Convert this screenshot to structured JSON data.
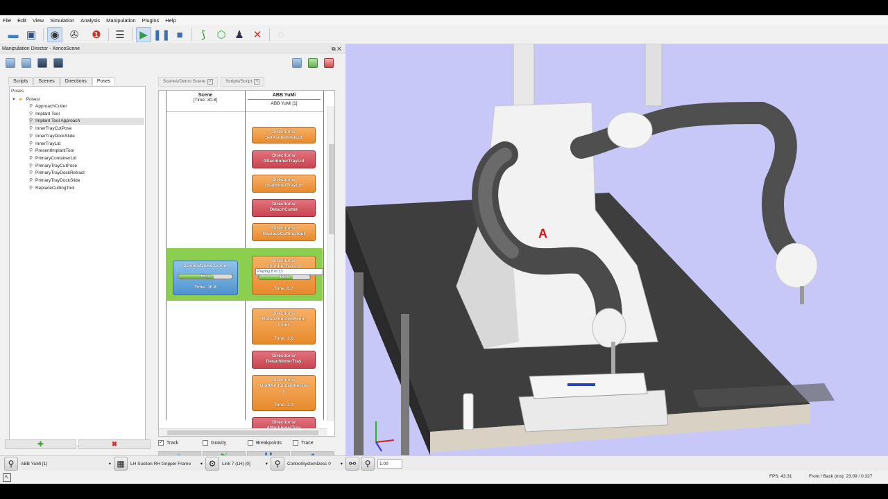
{
  "menu": [
    "File",
    "Edit",
    "View",
    "Simulation",
    "Analysis",
    "Manipulation",
    "Plugins",
    "Help"
  ],
  "panel": {
    "title": "Manipulation Director - XencoScene",
    "title_buttons": "⧉ ✕"
  },
  "left_tabs": [
    "Scripts",
    "Scenes",
    "Directions",
    "Poses"
  ],
  "active_left_tab": "Poses",
  "tree": {
    "header": "Poses",
    "folder": "Poses/",
    "items": [
      "ApproachCutter",
      "Implant Tool",
      "Implant Tool Approach",
      "InnerTrayCutPose",
      "InnerTrayDockSlide",
      "InnerTrayLid",
      "PresentImplantTool",
      "PrimaryContainerLid",
      "PrimaryTrayCutPose",
      "PrimaryTrayDockRetract",
      "PrimaryTrayDockSlide",
      "ReplaceCuttingTool"
    ],
    "selected_index": 2
  },
  "left_buttons": {
    "add": "✚",
    "remove": "✖"
  },
  "doc_tabs": [
    "Scenes/Demo Scene",
    "Scripts/Script"
  ],
  "columns": {
    "scene_title": "Scene",
    "scene_time": "[Time: 30.8]",
    "robot_title": "ABB YuMi",
    "robot_sub": "ABB YuMi [1]"
  },
  "scene_block": {
    "title": "Scenes/Demo Scene",
    "progress_label": "66%",
    "progress": 0.66,
    "time": "Time: 30.8"
  },
  "blocks": [
    {
      "color": "orange",
      "line1": "Directions/",
      "line2": "SetAsideInnerLid",
      "time": ""
    },
    {
      "color": "red",
      "line1": "Directions/",
      "line2": "AttachInnerTrayLid",
      "time": ""
    },
    {
      "color": "orange",
      "line1": "Directions/",
      "line2": "GrabInnerTrayLid",
      "time": ""
    },
    {
      "color": "red",
      "line1": "Directions/",
      "line2": "DetachCutter",
      "time": ""
    },
    {
      "color": "orange",
      "line1": "Directions/",
      "line2": "ReplaceCuttingTool",
      "time": ""
    },
    {
      "color": "orange",
      "line1": "Directions/",
      "line2": "CutInnerTrayLid",
      "time": "Time: 6.7"
    },
    {
      "color": "orange",
      "line1": "Directions/",
      "line2": "RetractSuctionFrom",
      "line3": "Inner",
      "time": "Time: 1.0"
    },
    {
      "color": "red",
      "line1": "Directions/",
      "line2": "DetachInnerTray",
      "time": ""
    },
    {
      "color": "orange",
      "line1": "Directions/",
      "line2": "GraftAndSlideInnerTra",
      "line3": "y",
      "time": "Time: 2.3"
    },
    {
      "color": "red",
      "line1": "Directions/",
      "line2": "AttachInnerTray",
      "time": ""
    }
  ],
  "active_block": {
    "progress_label": "66%",
    "progress": 0.66,
    "tooltip": "Playing 8 of 13"
  },
  "checkboxes": [
    {
      "label": "Track",
      "checked": true
    },
    {
      "label": "Gravity",
      "checked": false
    },
    {
      "label": "Breakpoints",
      "checked": false
    },
    {
      "label": "Trace",
      "checked": false
    }
  ],
  "controls": [
    "▶",
    "▶|",
    "❚❚",
    "■"
  ],
  "bottom": {
    "robot": "ABB YuMi [1]",
    "frame": "LH Suction RH Gripper Frame",
    "link": "Link 7 (LH) [0]",
    "system": "ControlSystemDesc 0",
    "value": "1.00"
  },
  "status": {
    "fps": "FPS: 43.31",
    "frontback": "Front / Back (ms): 23.09 / 0.327"
  },
  "colors": {
    "viewport_bg": "#c8c8f8",
    "green_band": "#8ccf50",
    "orange": "#e88a2d",
    "red": "#c84551",
    "blue": "#4f93cf"
  }
}
